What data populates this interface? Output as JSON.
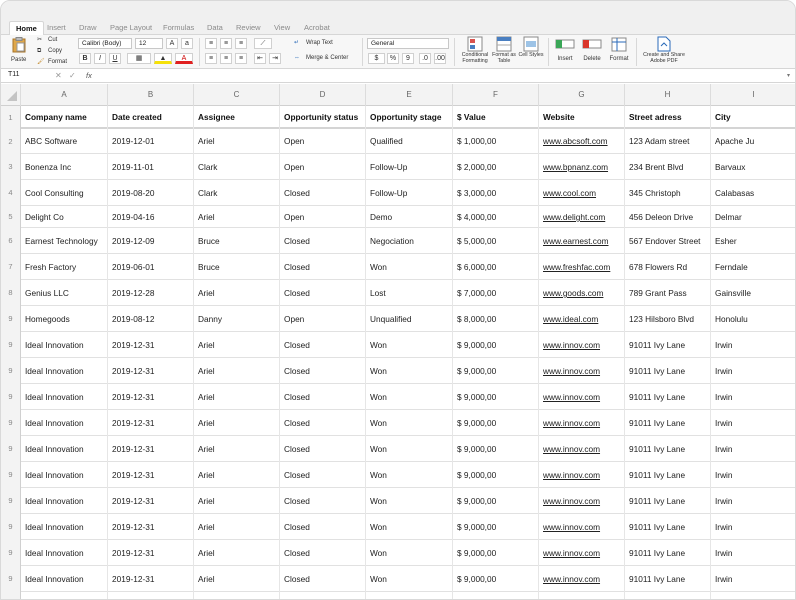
{
  "ribbon_tabs": [
    "Home",
    "Insert",
    "Draw",
    "Page Layout",
    "Formulas",
    "Data",
    "Review",
    "View",
    "Acrobat"
  ],
  "ribbon": {
    "paste": "Paste",
    "cut": "Cut",
    "copy": "Copy",
    "format_painter": "Format",
    "font_name": "Calibri (Body)",
    "font_size": "12",
    "bold": "B",
    "italic": "I",
    "underline": "U",
    "wrap_text": "Wrap Text",
    "merge_center": "Merge & Center",
    "number_format": "General",
    "currency": "$",
    "percent": "%",
    "comma": "9",
    "conditional_formatting": "Conditional Formatting",
    "format_as_table": "Format as Table",
    "cell_styles": "Cell Styles",
    "insert": "Insert",
    "delete": "Delete",
    "format": "Format",
    "create_share_pdf": "Create and Share Adobe PDF"
  },
  "formula_bar": {
    "name_box": "T11",
    "fx": "fx",
    "value": ""
  },
  "columns": [
    "A",
    "B",
    "C",
    "D",
    "E",
    "F",
    "G",
    "H",
    "I"
  ],
  "header_row": {
    "num": "1",
    "cells": [
      "Company name",
      "Date created",
      "Assignee",
      "Opportunity status",
      "Opportunity stage",
      "$ Value",
      "Website",
      "Street adress",
      "City"
    ]
  },
  "rows": [
    {
      "num": "2",
      "cells": [
        "ABC Software",
        "2019-12-01",
        "Ariel",
        "Open",
        "Qualified",
        "$ 1,000,00",
        "www.abcsoft.com",
        "123 Adam street",
        "Apache Ju"
      ]
    },
    {
      "num": "3",
      "cells": [
        "Bonenza Inc",
        "2019-11-01",
        "Clark",
        "Open",
        "Follow-Up",
        "$ 2,000,00",
        "www.bpnanz.com",
        "234 Brent Blvd",
        "Barvaux"
      ]
    },
    {
      "num": "4",
      "cells": [
        "Cool Consulting",
        "2019-08-20",
        "Clark",
        "Closed",
        "Follow-Up",
        "$ 3,000,00",
        "www.cool.com",
        "345 Christoph",
        "Calabasas"
      ]
    },
    {
      "num": "5",
      "cells": [
        "Delight Co",
        "2019-04-16",
        "Ariel",
        "Open",
        "Demo",
        "$ 4,000,00",
        "www.delight.com",
        "456 Deleon Drive",
        "Delmar"
      ]
    },
    {
      "num": "6",
      "cells": [
        "Earnest Technology",
        "2019-12-09",
        "Bruce",
        "Closed",
        "Negociation",
        "$ 5,000,00",
        "www.earnest.com",
        "567 Endover Street",
        "Esher"
      ]
    },
    {
      "num": "7",
      "cells": [
        "Fresh Factory",
        "2019-06-01",
        "Bruce",
        "Closed",
        "Won",
        "$ 6,000,00",
        "www.freshfac.com",
        "678 Flowers Rd",
        "Ferndale"
      ]
    },
    {
      "num": "8",
      "cells": [
        "Genius LLC",
        "2019-12-28",
        "Ariel",
        "Closed",
        "Lost",
        "$ 7,000,00",
        "www.goods.com",
        "789 Grant Pass",
        "Gainsville"
      ]
    },
    {
      "num": "9",
      "cells": [
        "Homegoods",
        "2019-08-12",
        "Danny",
        "Open",
        "Unqualified",
        "$ 8,000,00",
        "www.ideal.com",
        "123 Hilsboro Blvd",
        "Honolulu"
      ]
    },
    {
      "num": "9",
      "cells": [
        "Ideal Innovation",
        "2019-12-31",
        "Ariel",
        "Closed",
        "Won",
        "$ 9,000,00",
        "www.innov.com",
        "91011 Ivy Lane",
        "Irwin"
      ]
    },
    {
      "num": "9",
      "cells": [
        "Ideal Innovation",
        "2019-12-31",
        "Ariel",
        "Closed",
        "Won",
        "$ 9,000,00",
        "www.innov.com",
        "91011 Ivy Lane",
        "Irwin"
      ]
    },
    {
      "num": "9",
      "cells": [
        "Ideal Innovation",
        "2019-12-31",
        "Ariel",
        "Closed",
        "Won",
        "$ 9,000,00",
        "www.innov.com",
        "91011 Ivy Lane",
        "Irwin"
      ]
    },
    {
      "num": "9",
      "cells": [
        "Ideal Innovation",
        "2019-12-31",
        "Ariel",
        "Closed",
        "Won",
        "$ 9,000,00",
        "www.innov.com",
        "91011 Ivy Lane",
        "Irwin"
      ]
    },
    {
      "num": "9",
      "cells": [
        "Ideal Innovation",
        "2019-12-31",
        "Ariel",
        "Closed",
        "Won",
        "$ 9,000,00",
        "www.innov.com",
        "91011 Ivy Lane",
        "Irwin"
      ]
    },
    {
      "num": "9",
      "cells": [
        "Ideal Innovation",
        "2019-12-31",
        "Ariel",
        "Closed",
        "Won",
        "$ 9,000,00",
        "www.innov.com",
        "91011 Ivy Lane",
        "Irwin"
      ]
    },
    {
      "num": "9",
      "cells": [
        "Ideal Innovation",
        "2019-12-31",
        "Ariel",
        "Closed",
        "Won",
        "$ 9,000,00",
        "www.innov.com",
        "91011 Ivy Lane",
        "Irwin"
      ]
    },
    {
      "num": "9",
      "cells": [
        "Ideal Innovation",
        "2019-12-31",
        "Ariel",
        "Closed",
        "Won",
        "$ 9,000,00",
        "www.innov.com",
        "91011 Ivy Lane",
        "Irwin"
      ]
    },
    {
      "num": "9",
      "cells": [
        "Ideal Innovation",
        "2019-12-31",
        "Ariel",
        "Closed",
        "Won",
        "$ 9,000,00",
        "www.innov.com",
        "91011 Ivy Lane",
        "Irwin"
      ]
    },
    {
      "num": "9",
      "cells": [
        "Ideal Innovation",
        "2019-12-31",
        "Ariel",
        "Closed",
        "Won",
        "$ 9,000,00",
        "www.innov.com",
        "91011 Ivy Lane",
        "Irwin"
      ]
    },
    {
      "num": "9",
      "cells": [
        "Ideal Innovation",
        "2019-12-31",
        "Ariel",
        "Closed",
        "Won",
        "$ 9,000,00",
        "www.innov.com",
        "91011 Ivy Lane",
        "Irwin"
      ]
    }
  ]
}
